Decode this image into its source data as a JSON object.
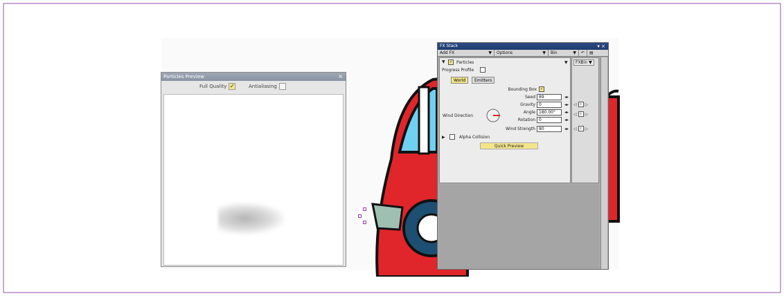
{
  "particles_preview": {
    "title": "Particles Preview",
    "close": "×",
    "full_quality_label": "Full Quality",
    "full_quality_checked": true,
    "antialiasing_label": "Antialiasing",
    "antialiasing_checked": false
  },
  "fx_stack": {
    "title": "FX Stack",
    "window_controls": "▾ ×",
    "menus": {
      "add_fx": "Add FX",
      "options": "Options",
      "bin": "Bin"
    },
    "effect_name": "Particles",
    "progress_profile": "Progress Profile",
    "fxbin_label": "FXBin",
    "tabs": {
      "world": "World",
      "emitters": "Emitters"
    },
    "params": {
      "bounding_box_label": "Bounding Box",
      "seed_label": "Seed",
      "seed_value": "89",
      "gravity_label": "Gravity",
      "gravity_value": "0",
      "wind_direction_label": "Wind Direction",
      "angle_label": "Angle",
      "angle_value": "180.00°",
      "rotation_label": "Rotation",
      "rotation_value": "0",
      "wind_strength_label": "Wind Strength",
      "wind_strength_value": "80"
    },
    "alpha_collision_label": "Alpha Collision",
    "quick_preview_label": "Quick Preview",
    "c_label": "c"
  },
  "icons": {
    "check": "✓",
    "triangle_down": "▼",
    "triangle_right": "▶",
    "lr_arrows": "◂▸"
  },
  "colors": {
    "car_red": "#e0262b",
    "car_window": "#6fd1f2",
    "checkbox_on": "#f3e58a",
    "panel_title": "#2a4b82"
  }
}
